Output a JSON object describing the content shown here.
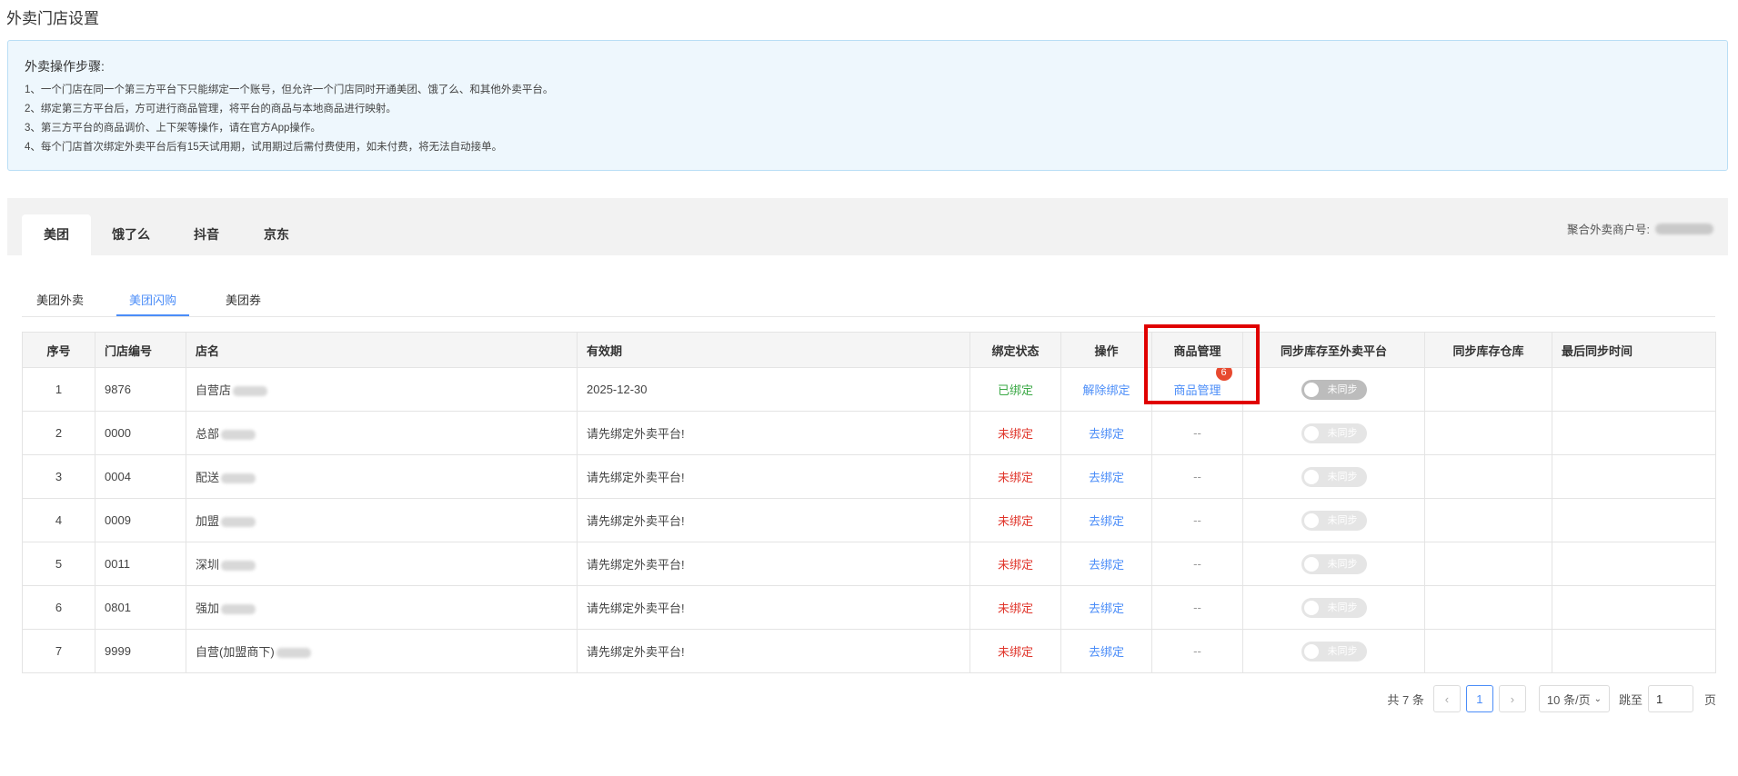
{
  "page_title": "外卖门店设置",
  "notice": {
    "title": "外卖操作步骤:",
    "lines": [
      "1、一个门店在同一个第三方平台下只能绑定一个账号，但允许一个门店同时开通美团、饿了么、和其他外卖平台。",
      "2、绑定第三方平台后，方可进行商品管理，将平台的商品与本地商品进行映射。",
      "3、第三方平台的商品调价、上下架等操作，请在官方App操作。",
      "4、每个门店首次绑定外卖平台后有15天试用期，试用期过后需付费使用，如未付费，将无法自动接单。"
    ]
  },
  "platform_tabs": [
    "美团",
    "饿了么",
    "抖音",
    "京东"
  ],
  "merchant_label": "聚合外卖商户号:",
  "sub_tabs": [
    "美团外卖",
    "美团闪购",
    "美团券"
  ],
  "table": {
    "headers": [
      "序号",
      "门店编号",
      "店名",
      "有效期",
      "绑定状态",
      "操作",
      "商品管理",
      "同步库存至外卖平台",
      "同步库存仓库",
      "最后同步时间"
    ],
    "rows": [
      {
        "no": "1",
        "code": "9876",
        "name": "自营店",
        "validity": "2025-12-30",
        "status": "已绑定",
        "action": "解除绑定",
        "goods": "商品管理",
        "badge": "6",
        "sync": "未同步"
      },
      {
        "no": "2",
        "code": "0000",
        "name": "总部",
        "validity": "请先绑定外卖平台!",
        "status": "未绑定",
        "action": "去绑定",
        "goods": "--",
        "sync": "未同步"
      },
      {
        "no": "3",
        "code": "0004",
        "name": "配送",
        "validity": "请先绑定外卖平台!",
        "status": "未绑定",
        "action": "去绑定",
        "goods": "--",
        "sync": "未同步"
      },
      {
        "no": "4",
        "code": "0009",
        "name": "加盟",
        "validity": "请先绑定外卖平台!",
        "status": "未绑定",
        "action": "去绑定",
        "goods": "--",
        "sync": "未同步"
      },
      {
        "no": "5",
        "code": "0011",
        "name": "深圳",
        "validity": "请先绑定外卖平台!",
        "status": "未绑定",
        "action": "去绑定",
        "goods": "--",
        "sync": "未同步"
      },
      {
        "no": "6",
        "code": "0801",
        "name": "强加",
        "validity": "请先绑定外卖平台!",
        "status": "未绑定",
        "action": "去绑定",
        "goods": "--",
        "sync": "未同步"
      },
      {
        "no": "7",
        "code": "9999",
        "name": "自营(加盟商下)",
        "validity": "请先绑定外卖平台!",
        "status": "未绑定",
        "action": "去绑定",
        "goods": "--",
        "sync": "未同步"
      }
    ]
  },
  "pagination": {
    "total": "共 7 条",
    "prev": "‹",
    "current": "1",
    "next": "›",
    "page_size": "10 条/页",
    "goto_label": "跳至",
    "goto_value": "1",
    "page_suffix": "页"
  },
  "colors": {
    "accent": "#4b8df8",
    "bound": "#3aa845",
    "unbound": "#e0352b",
    "highlight": "#e00000"
  }
}
